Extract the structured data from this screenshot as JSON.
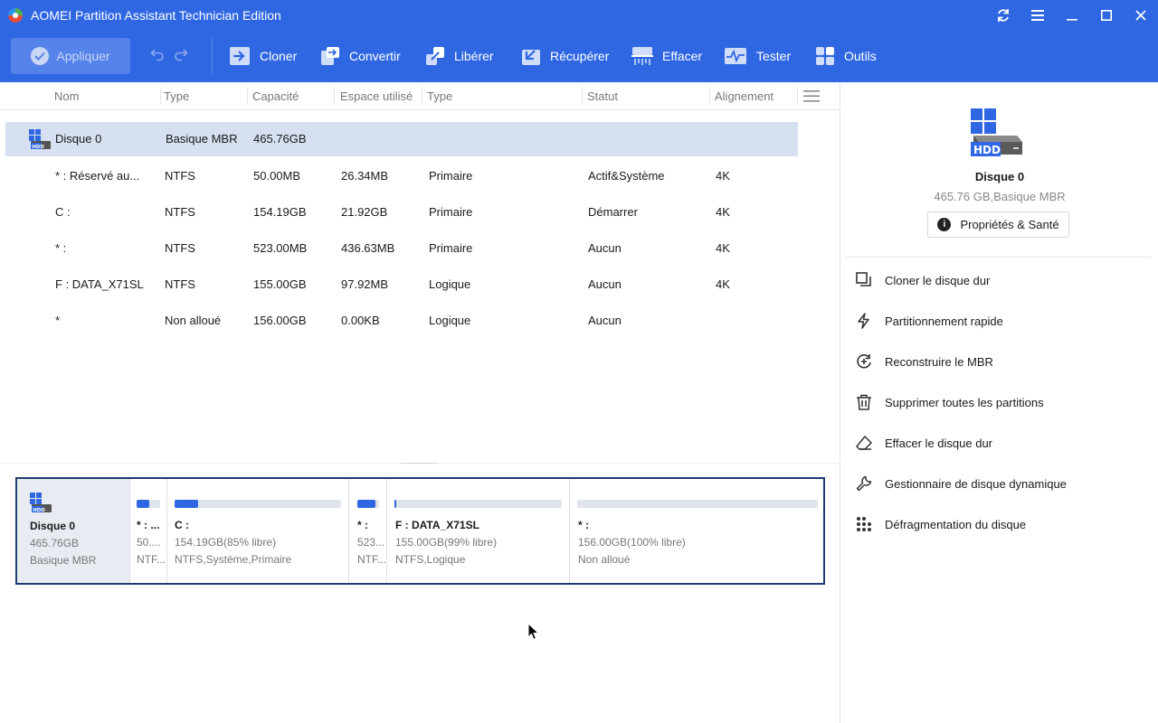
{
  "window": {
    "title": "AOMEI Partition Assistant Technician Edition"
  },
  "toolbar": {
    "apply_label": "Appliquer",
    "items": [
      {
        "label": "Cloner",
        "icon": "clone-icon"
      },
      {
        "label": "Convertir",
        "icon": "convert-icon"
      },
      {
        "label": "Libérer",
        "icon": "free-icon"
      },
      {
        "label": "Récupérer",
        "icon": "recover-icon"
      },
      {
        "label": "Effacer",
        "icon": "wipe-icon"
      },
      {
        "label": "Tester",
        "icon": "test-icon"
      },
      {
        "label": "Outils",
        "icon": "tools-icon"
      }
    ]
  },
  "table": {
    "columns": [
      "Nom",
      "Type",
      "Capacité",
      "Espace utilisé",
      "Type",
      "Statut",
      "Alignement"
    ],
    "disk_row": {
      "name": "Disque 0",
      "type": "Basique MBR",
      "capacity": "465.76GB"
    },
    "partitions": [
      {
        "name": "* : Réservé au...",
        "fs": "NTFS",
        "capacity": "50.00MB",
        "used": "26.34MB",
        "ptype": "Primaire",
        "status": "Actif&Système",
        "align": "4K"
      },
      {
        "name": "C :",
        "fs": "NTFS",
        "capacity": "154.19GB",
        "used": "21.92GB",
        "ptype": "Primaire",
        "status": "Démarrer",
        "align": "4K"
      },
      {
        "name": "* :",
        "fs": "NTFS",
        "capacity": "523.00MB",
        "used": "436.63MB",
        "ptype": "Primaire",
        "status": "Aucun",
        "align": "4K"
      },
      {
        "name": "F : DATA_X71SL",
        "fs": "NTFS",
        "capacity": "155.00GB",
        "used": "97.92MB",
        "ptype": "Logique",
        "status": "Aucun",
        "align": "4K"
      },
      {
        "name": "*",
        "fs": "Non alloué",
        "capacity": "156.00GB",
        "used": "0.00KB",
        "ptype": "Logique",
        "status": "Aucun",
        "align": ""
      }
    ]
  },
  "diskmap": {
    "disk": {
      "name": "Disque 0",
      "size": "465.76GB",
      "type": "Basique MBR"
    },
    "parts": [
      {
        "name": "* : ...",
        "size": "50....",
        "fs": "NTF...",
        "used_fraction": 0.53
      },
      {
        "name": "C :",
        "size": "154.19GB(85% libre)",
        "fs": "NTFS,Système,Primaire",
        "used_fraction": 0.14
      },
      {
        "name": "* :",
        "size": "523...",
        "fs": "NTF...",
        "used_fraction": 0.83
      },
      {
        "name": "F : DATA_X71SL",
        "size": "155.00GB(99% libre)",
        "fs": "NTFS,Logique",
        "used_fraction": 0.01
      },
      {
        "name": "* :",
        "size": "156.00GB(100% libre)",
        "fs": "Non alloué",
        "used_fraction": 0.0
      }
    ]
  },
  "right_panel": {
    "disk_name": "Disque 0",
    "disk_info": "465.76 GB,Basique MBR",
    "props_button": "Propriétés & Santé",
    "hdd_label": "HDD",
    "actions": [
      {
        "label": "Cloner le disque dur",
        "icon": "clone-disk-icon"
      },
      {
        "label": "Partitionnement rapide",
        "icon": "lightning-icon"
      },
      {
        "label": "Reconstruire le MBR",
        "icon": "rebuild-mbr-icon"
      },
      {
        "label": "Supprimer toutes les partitions",
        "icon": "trash-icon"
      },
      {
        "label": "Effacer le disque dur",
        "icon": "eraser-icon"
      },
      {
        "label": "Gestionnaire de disque dynamique",
        "icon": "wrench-icon"
      },
      {
        "label": "Défragmentation du disque",
        "icon": "defrag-icon"
      }
    ]
  },
  "colors": {
    "accent": "#2f67e3",
    "selected_row": "#d6e0f0",
    "diskmap_border": "#1f3a6e"
  }
}
